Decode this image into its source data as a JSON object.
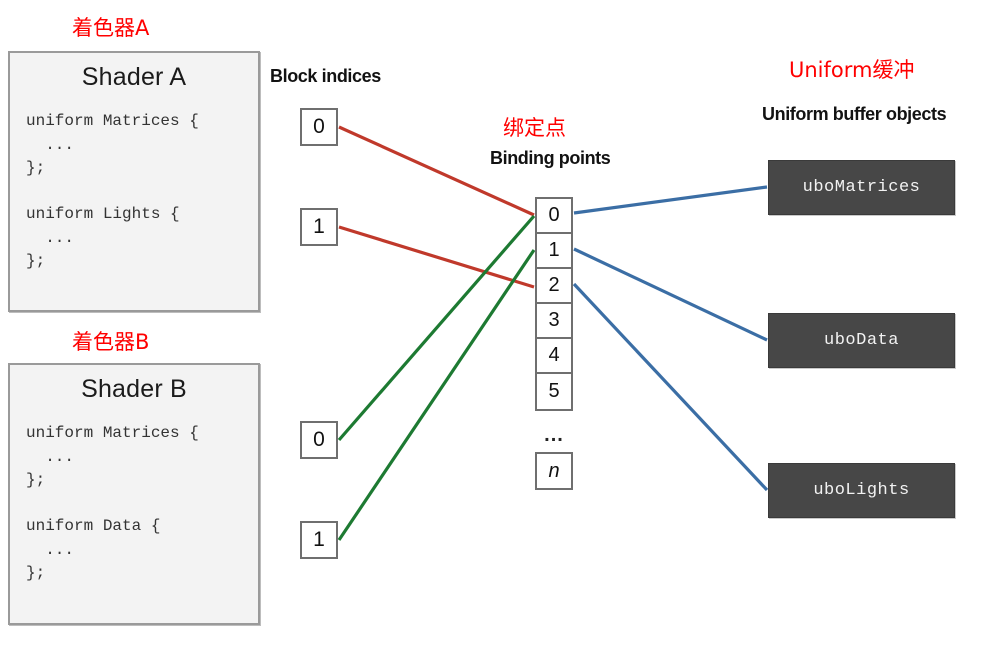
{
  "diagram": {
    "title_note_cn_shader_a": "着色器A",
    "title_note_cn_shader_b": "着色器B",
    "title_note_cn_binding": "绑定点",
    "title_note_cn_uniform_buffer": "Uniform缓冲",
    "header_block_indices": "Block indices",
    "header_binding_points": "Binding points",
    "header_ubo": "Uniform buffer objects",
    "ellipsis": "...",
    "n_label": "n"
  },
  "shaders": [
    {
      "name": "Shader A",
      "cn_label": "着色器A",
      "blocks": [
        {
          "code": "uniform Matrices {\n  ...\n};",
          "name": "Matrices",
          "index": "0"
        },
        {
          "code": "uniform Lights {\n  ...\n};",
          "name": "Lights",
          "index": "1"
        }
      ]
    },
    {
      "name": "Shader B",
      "cn_label": "着色器B",
      "blocks": [
        {
          "code": "uniform Matrices {\n  ...\n};",
          "name": "Matrices",
          "index": "0"
        },
        {
          "code": "uniform Data {\n  ...\n};",
          "name": "Data",
          "index": "1"
        }
      ]
    }
  ],
  "block_indices": [
    {
      "value": "0",
      "owner": "Shader A",
      "block": "Matrices"
    },
    {
      "value": "1",
      "owner": "Shader A",
      "block": "Lights"
    },
    {
      "value": "0",
      "owner": "Shader B",
      "block": "Matrices"
    },
    {
      "value": "1",
      "owner": "Shader B",
      "block": "Data"
    }
  ],
  "binding_points": [
    "0",
    "1",
    "2",
    "3",
    "4",
    "5"
  ],
  "uniform_buffer_objects": [
    {
      "label": "uboMatrices"
    },
    {
      "label": "uboData"
    },
    {
      "label": "uboLights"
    }
  ],
  "colors": {
    "shader_a_link": "#c0392b",
    "shader_b_link": "#1d7a32",
    "ubo_link": "#3b6ea5",
    "annotation": "#ff0000",
    "ubo_fill": "#474747",
    "panel_fill": "#f3f3f3",
    "panel_border": "#9a9a9a"
  },
  "connections": [
    {
      "from": "ShaderA.blockIndex0",
      "to": "binding.0",
      "color": "#c0392b"
    },
    {
      "from": "ShaderA.blockIndex1",
      "to": "binding.2",
      "color": "#c0392b"
    },
    {
      "from": "ShaderB.blockIndex0",
      "to": "binding.0",
      "color": "#1d7a32"
    },
    {
      "from": "ShaderB.blockIndex1",
      "to": "binding.1",
      "color": "#1d7a32"
    },
    {
      "from": "binding.0",
      "to": "uboMatrices",
      "color": "#3b6ea5"
    },
    {
      "from": "binding.1",
      "to": "uboData",
      "color": "#3b6ea5"
    },
    {
      "from": "binding.2",
      "to": "uboLights",
      "color": "#3b6ea5"
    }
  ]
}
